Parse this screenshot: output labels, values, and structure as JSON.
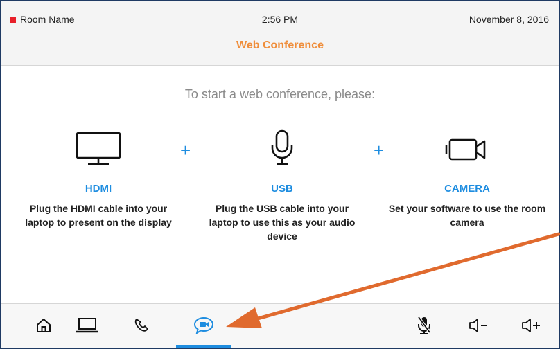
{
  "header": {
    "room_name": "Room Name",
    "time": "2:56 PM",
    "date": "November 8, 2016",
    "title": "Web Conference"
  },
  "main": {
    "prompt": "To start a web conference, please:",
    "plus_symbol": "+",
    "steps": [
      {
        "icon": "monitor-icon",
        "label": "HDMI",
        "description": "Plug the HDMI cable into your laptop to present on the display"
      },
      {
        "icon": "microphone-icon",
        "label": "USB",
        "description": "Plug the USB cable into your laptop to use this as your audio device"
      },
      {
        "icon": "camera-icon",
        "label": "CAMERA",
        "description": "Set your software to use the room camera"
      }
    ]
  },
  "bottom_nav": {
    "items": [
      {
        "icon": "home-icon"
      },
      {
        "icon": "laptop-icon"
      },
      {
        "icon": "phone-icon"
      },
      {
        "icon": "web-conference-icon",
        "active": true
      },
      {
        "icon": "mic-mute-icon"
      },
      {
        "icon": "volume-down-icon"
      },
      {
        "icon": "volume-up-icon"
      }
    ]
  },
  "colors": {
    "accent_blue": "#1e8de0",
    "title_orange": "#ef8d3a",
    "room_red": "#e8202a",
    "arrow_orange": "#e06a2e",
    "frame_navy": "#1f3a63"
  }
}
